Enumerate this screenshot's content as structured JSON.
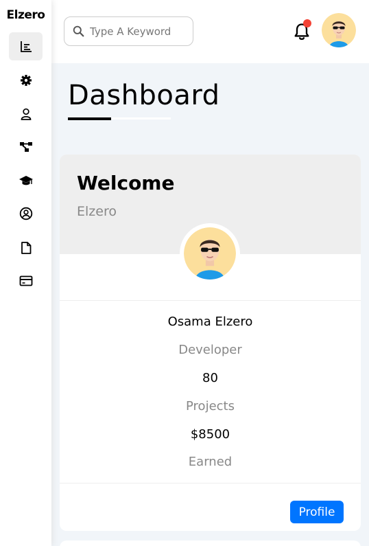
{
  "sidebar": {
    "brand": "Elzero",
    "items": [
      {
        "icon": "chart-icon",
        "active": true
      },
      {
        "icon": "gear-icon",
        "active": false
      },
      {
        "icon": "user-icon",
        "active": false
      },
      {
        "icon": "diagram-icon",
        "active": false
      },
      {
        "icon": "graduation-cap-icon",
        "active": false
      },
      {
        "icon": "user-circle-icon",
        "active": false
      },
      {
        "icon": "file-icon",
        "active": false
      },
      {
        "icon": "credit-card-icon",
        "active": false
      }
    ]
  },
  "header": {
    "search_placeholder": "Type A Keyword",
    "notification_icon": "bell-icon",
    "notification_dot_color": "#f44336"
  },
  "main": {
    "title": "Dashboard"
  },
  "welcome_card": {
    "heading": "Welcome",
    "subheading": "Elzero",
    "name": "Osama Elzero",
    "role": "Developer",
    "projects_value": "80",
    "projects_label": "Projects",
    "earned_value": "$8500",
    "earned_label": "Earned",
    "profile_button": "Profile"
  },
  "colors": {
    "accent": "#0075ff",
    "background": "#f1f5f9",
    "muted_text": "#888888"
  }
}
